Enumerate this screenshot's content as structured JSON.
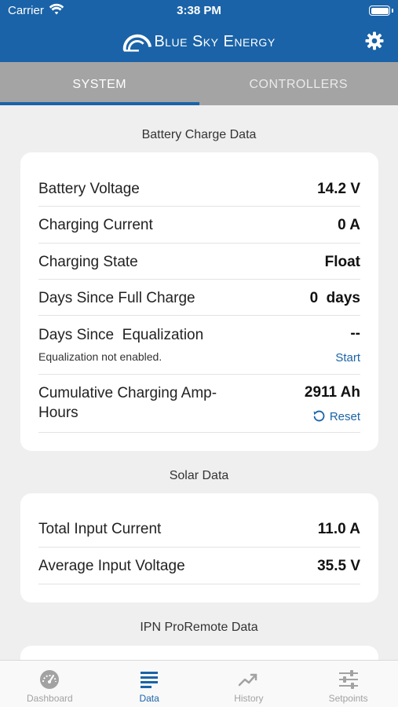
{
  "status_bar": {
    "carrier": "Carrier",
    "time": "3:38 PM"
  },
  "header": {
    "brand": "Blue Sky Energy",
    "settings_icon": "gear-icon"
  },
  "tabs": [
    {
      "label": "SYSTEM",
      "active": true
    },
    {
      "label": "CONTROLLERS",
      "active": false
    }
  ],
  "battery_section": {
    "title": "Battery Charge Data",
    "battery_voltage": {
      "label": "Battery Voltage",
      "value": "14.2 V"
    },
    "charging_current": {
      "label": "Charging Current",
      "value": "0 A"
    },
    "charging_state": {
      "label": "Charging State",
      "value": "Float"
    },
    "days_full_charge": {
      "label": "Days Since Full Charge",
      "value": "0  days"
    },
    "days_equalization": {
      "label": "Days Since  Equalization",
      "value": "--",
      "note": "Equalization not enabled.",
      "action": "Start"
    },
    "amp_hours": {
      "label_line1": "Cumulative Charging Amp-",
      "label_line2": "Hours",
      "value": "2911 Ah",
      "action": "Reset"
    }
  },
  "solar_section": {
    "title": "Solar Data",
    "input_current": {
      "label": "Total Input Current",
      "value": "11.0 A"
    },
    "input_voltage": {
      "label": "Average Input Voltage",
      "value": "35.5 V"
    }
  },
  "ipn_section": {
    "title": "IPN ProRemote Data"
  },
  "tab_bar": [
    {
      "label": "Dashboard",
      "icon": "gauge-icon",
      "active": false
    },
    {
      "label": "Data",
      "icon": "list-icon",
      "active": true
    },
    {
      "label": "History",
      "icon": "chart-line-icon",
      "active": false
    },
    {
      "label": "Setpoints",
      "icon": "sliders-icon",
      "active": false
    }
  ],
  "colors": {
    "brand_blue": "#1a63a8",
    "tab_bg": "#a4a4a4",
    "page_bg": "#efefef"
  }
}
